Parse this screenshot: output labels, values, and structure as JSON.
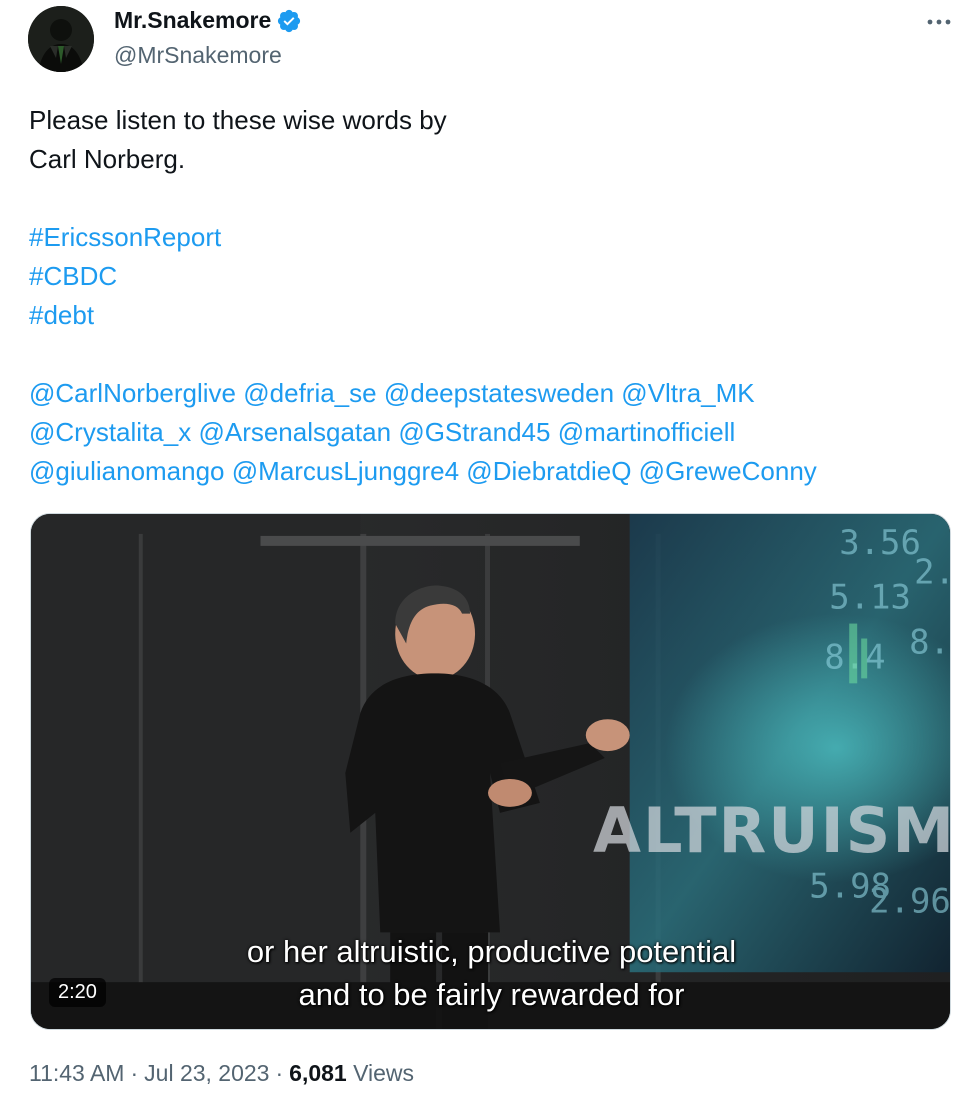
{
  "author": {
    "display_name": "Mr.Snakemore",
    "handle": "@MrSnakemore",
    "verified": true,
    "avatar_icon": "avatar-image"
  },
  "more_icon": "more-horizontal-icon",
  "tweet": {
    "lines": [
      "Please listen to these wise words by",
      "Carl Norberg."
    ],
    "hashtags": [
      "#EricssonReport",
      "#CBDC",
      "#debt"
    ],
    "mention_rows": [
      [
        "@CarlNorberglive",
        "@defria_se",
        "@deepstatesweden",
        "@Vltra_MK"
      ],
      [
        "@Crystalita_x",
        "@Arsenalsgatan",
        "@GStrand45",
        "@martinofficiell"
      ],
      [
        "@giulianomango",
        "@MarcusLjunggre4",
        "@DiebratdieQ",
        "@GreweConny"
      ]
    ]
  },
  "video": {
    "duration": "2:20",
    "overlay_word": "ALTRUISM",
    "subtitle_line1": "or her altruistic, productive potential",
    "subtitle_line2": "and to be fairly rewarded for",
    "screen_numbers": [
      "3.56",
      "5.13",
      "8.4",
      "2.96",
      "5.98",
      "2.",
      "8."
    ]
  },
  "meta": {
    "time": "11:43 AM",
    "separator": "·",
    "date": "Jul 23, 2023",
    "views_count": "6,081",
    "views_label": "Views"
  },
  "colors": {
    "link": "#1d9bf0",
    "text": "#0f1419",
    "secondary": "#536471"
  }
}
